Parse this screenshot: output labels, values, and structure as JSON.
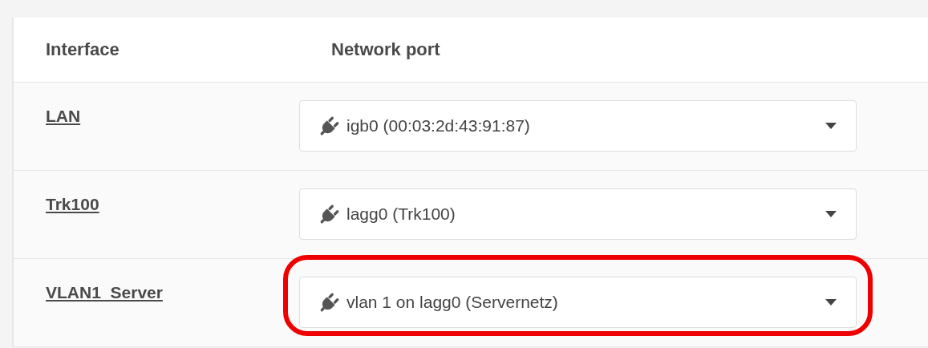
{
  "table": {
    "columns": [
      "Interface",
      "Network port"
    ],
    "rows": [
      {
        "interface": "LAN",
        "port": "igb0 (00:03:2d:43:91:87)",
        "highlighted": false
      },
      {
        "interface": "Trk100",
        "port": "lagg0 (Trk100)",
        "highlighted": false
      },
      {
        "interface": "VLAN1_Server",
        "port": "vlan 1 on lagg0 (Servernetz)",
        "highlighted": true
      }
    ]
  }
}
